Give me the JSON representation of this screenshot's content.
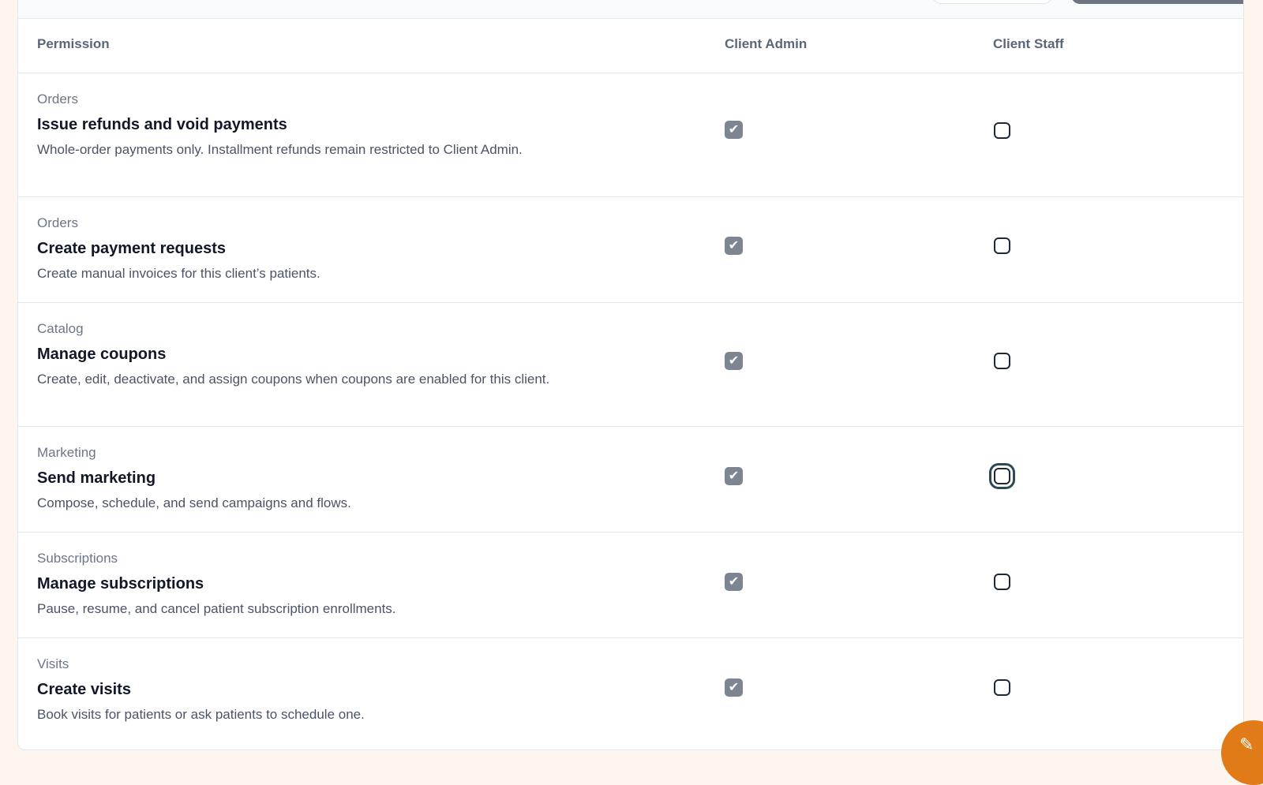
{
  "header": {
    "permission": "Permission",
    "client_admin": "Client Admin",
    "client_staff": "Client Staff"
  },
  "rows": [
    {
      "category": "Orders",
      "title": "Issue refunds and void payments",
      "description": "Whole-order payments only. Installment refunds remain restricted to Client Admin.",
      "client_admin": true,
      "client_staff": false
    },
    {
      "category": "Orders",
      "title": "Create payment requests",
      "description": "Create manual invoices for this client’s patients.",
      "client_admin": true,
      "client_staff": false
    },
    {
      "category": "Catalog",
      "title": "Manage coupons",
      "description": "Create, edit, deactivate, and assign coupons when coupons are enabled for this client.",
      "client_admin": true,
      "client_staff": false
    },
    {
      "category": "Marketing",
      "title": "Send marketing",
      "description": "Compose, schedule, and send campaigns and flows.",
      "client_admin": true,
      "client_staff": false
    },
    {
      "category": "Subscriptions",
      "title": "Manage subscriptions",
      "description": "Pause, resume, and cancel patient subscription enrollments.",
      "client_admin": true,
      "client_staff": false
    },
    {
      "category": "Visits",
      "title": "Create visits",
      "description": "Book visits for patients or ask patients to schedule one.",
      "client_admin": true,
      "client_staff": false
    }
  ],
  "icons": {
    "checked": "check-icon",
    "fab": "pencil-icon"
  },
  "colors": {
    "accent": "#e07b18",
    "checked_fill": "#7d8593",
    "focus_ring": "#2b4a55"
  }
}
